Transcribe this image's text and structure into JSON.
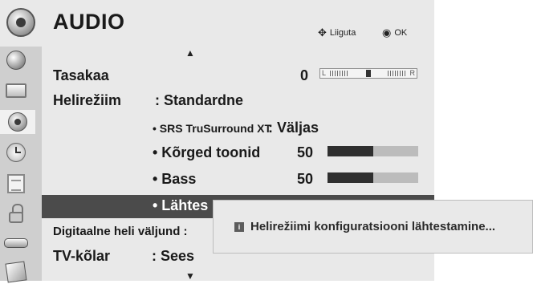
{
  "header": {
    "title": "AUDIO",
    "hint_move": "Liiguta",
    "hint_ok": "OK",
    "icon": "audio-disc-icon"
  },
  "nav": {
    "up": "▲",
    "down": "▼"
  },
  "sidebar": {
    "items": [
      {
        "icon": "globe-icon"
      },
      {
        "icon": "monitor-icon"
      },
      {
        "icon": "audio-disc-icon",
        "active": true
      },
      {
        "icon": "clock-icon"
      },
      {
        "icon": "calendar-icon"
      },
      {
        "icon": "lock-icon"
      },
      {
        "icon": "plug-icon"
      },
      {
        "icon": "photo-icon"
      }
    ]
  },
  "menu": {
    "balance": {
      "label": "Tasakaa",
      "value": "0",
      "left": "L",
      "right": "R"
    },
    "sound_mode": {
      "label": "Helirežiim",
      "value": ": Standardne"
    },
    "srs": {
      "label": "• SRS TruSurround XT",
      "value": ": Väljas"
    },
    "treble": {
      "label": "• Kõrged toonid",
      "value": "50",
      "level": 0.5
    },
    "bass": {
      "label": "• Bass",
      "value": "50",
      "level": 0.5
    },
    "reset": {
      "label": "• Lähtes"
    },
    "digital_out": {
      "label": "Digitaalne heli väljund :"
    },
    "tv_speaker": {
      "label": "TV-kõlar",
      "value": ": Sees"
    }
  },
  "popup": {
    "icon": "i",
    "text": "Helirežiimi konfiguratsiooni  lähtestamine..."
  }
}
